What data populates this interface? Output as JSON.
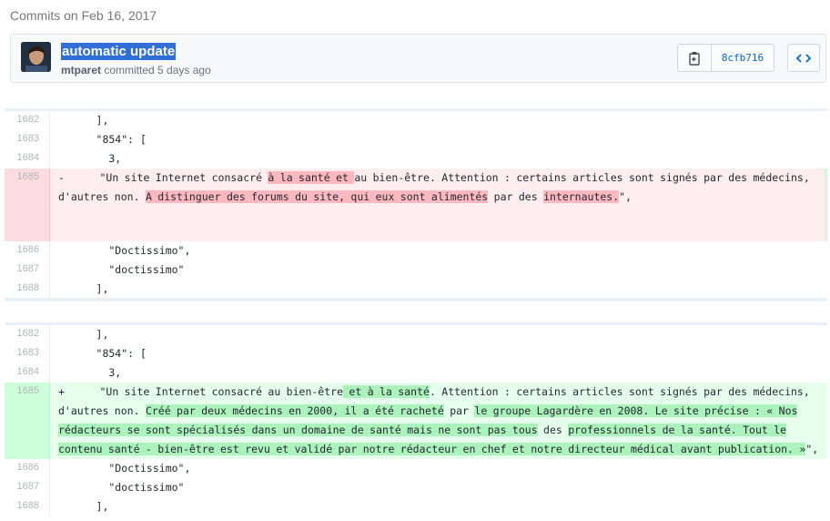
{
  "heading": "Commits on Feb 16, 2017",
  "commit": {
    "title": "automatic update",
    "author": "mtparet",
    "meta_rest": "committed 5 days ago",
    "sha": "8cfb716"
  },
  "icons": {
    "copy": "clipboard-icon",
    "browse": "code-icon"
  },
  "diff_old": {
    "lines": [
      {
        "num": "1682",
        "text": "      ],"
      },
      {
        "num": "1683",
        "text": "      \"854\": ["
      },
      {
        "num": "1684",
        "text": "        3,"
      }
    ],
    "deleted": {
      "num": "1685",
      "sign": "-",
      "pre": "      \"Un site Internet consacré ",
      "m1": "à la santé et ",
      "mid1": "au bien-être. Attention : certains articles sont signés par des médecins, d'autres non. ",
      "m2": "A distinguer des forums du site, qui eux sont alimentés",
      "mid2": " par des ",
      "m3": "internautes.",
      "post": "\","
    },
    "after": [
      {
        "num": "1686",
        "text": "        \"Doctissimo\","
      },
      {
        "num": "1687",
        "text": "        \"doctissimo\""
      },
      {
        "num": "1688",
        "text": "      ],"
      }
    ]
  },
  "diff_new": {
    "lines": [
      {
        "num": "1682",
        "text": "      ],"
      },
      {
        "num": "1683",
        "text": "      \"854\": ["
      },
      {
        "num": "1684",
        "text": "        3,"
      }
    ],
    "added": {
      "num": "1685",
      "sign": "+",
      "pre": "      \"Un site Internet consacré au bien-être",
      "m1": " et à la santé",
      "mid1": ". Attention : certains articles sont signés par des médecins, d'autres non. ",
      "m2": "Créé par deux médecins en 2000, il a été racheté",
      "mid2": " par ",
      "m3": "le groupe Lagardère en 2008. Le site précise : « Nos rédacteurs se sont spécialisés dans un domaine de santé mais ne sont pas tous",
      "mid3": " des ",
      "m4": "professionnels de la santé. Tout le contenu santé - bien-être est revu et validé par notre rédacteur en chef et notre directeur médical avant publication. »",
      "post": "\","
    },
    "after": [
      {
        "num": "1686",
        "text": "        \"Doctissimo\","
      },
      {
        "num": "1687",
        "text": "        \"doctissimo\""
      },
      {
        "num": "1688",
        "text": "      ],"
      }
    ]
  }
}
